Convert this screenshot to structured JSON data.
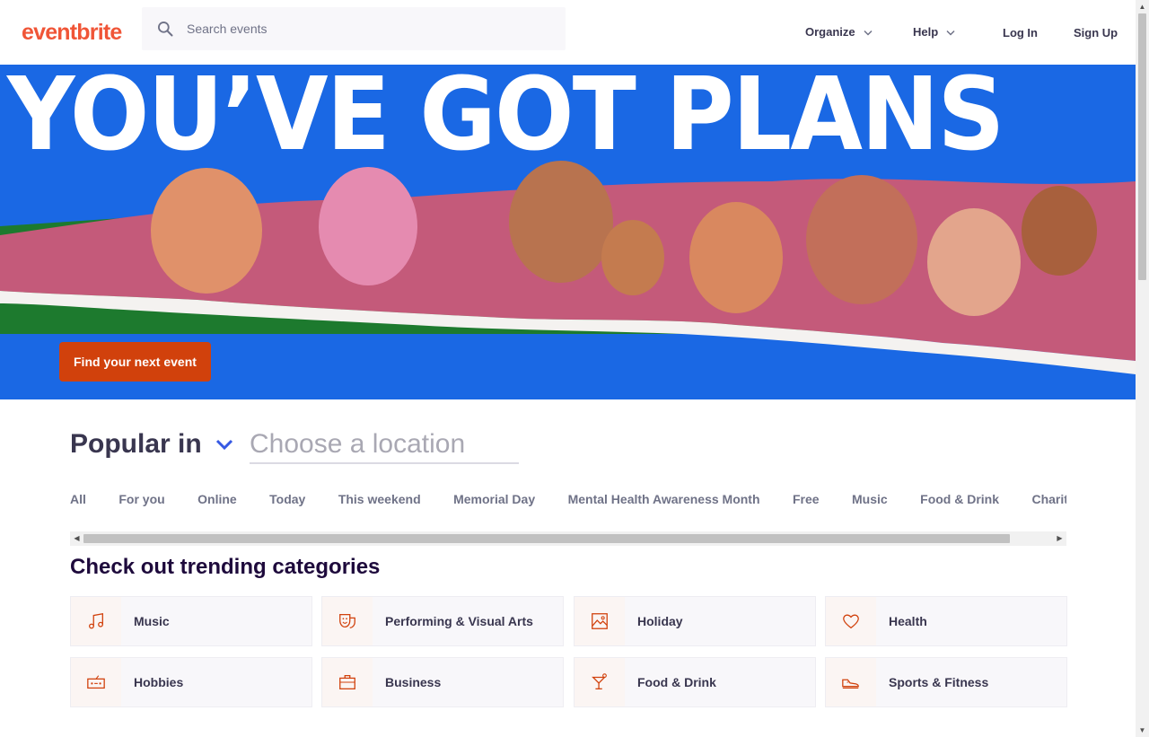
{
  "header": {
    "logo": "eventbrite",
    "search_placeholder": "Search events",
    "nav": {
      "organize": "Organize",
      "help": "Help",
      "login": "Log In",
      "signup": "Sign Up"
    }
  },
  "hero": {
    "headline": "YOU’VE GOT PLANS",
    "cta": "Find your next event"
  },
  "popular": {
    "label": "Popular in",
    "location_placeholder": "Choose a location",
    "tabs": [
      "All",
      "For you",
      "Online",
      "Today",
      "This weekend",
      "Memorial Day",
      "Mental Health Awareness Month",
      "Free",
      "Music",
      "Food & Drink",
      "Charity & Causes"
    ]
  },
  "trending": {
    "title": "Check out trending categories",
    "categories": [
      {
        "label": "Music",
        "icon": "music-note-icon"
      },
      {
        "label": "Performing & Visual Arts",
        "icon": "theater-mask-icon"
      },
      {
        "label": "Holiday",
        "icon": "picture-frame-icon"
      },
      {
        "label": "Health",
        "icon": "heart-icon"
      },
      {
        "label": "Hobbies",
        "icon": "radio-icon"
      },
      {
        "label": "Business",
        "icon": "briefcase-icon"
      },
      {
        "label": "Food & Drink",
        "icon": "cocktail-icon"
      },
      {
        "label": "Sports & Fitness",
        "icon": "sneaker-icon"
      }
    ]
  },
  "colors": {
    "brand": "#f05537",
    "cta": "#d1410c",
    "hero_bg": "#1a68e4",
    "icon": "#d1410c"
  }
}
